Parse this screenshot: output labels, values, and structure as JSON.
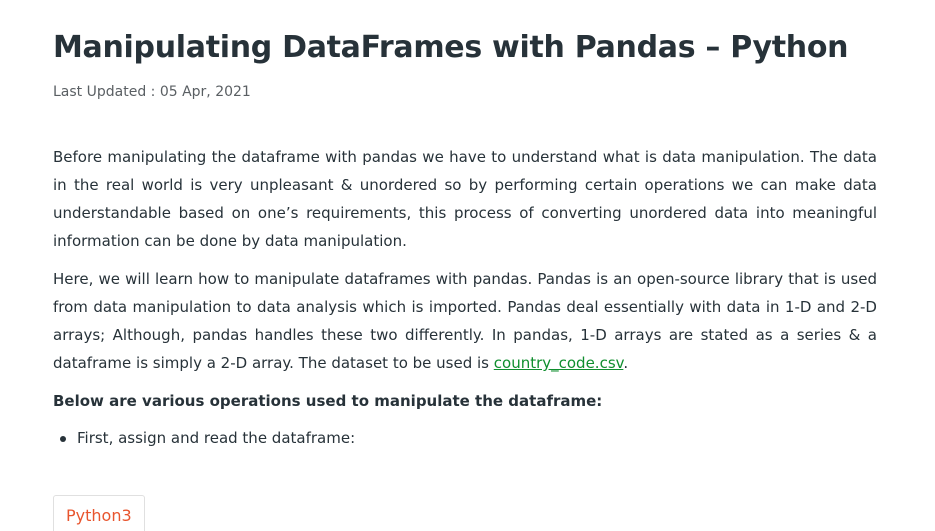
{
  "article": {
    "title": "Manipulating DataFrames with Pandas – Python",
    "last_updated": "Last Updated : 05 Apr, 2021",
    "paragraph1": "Before manipulating the dataframe with pandas we have to understand what is data manipulation. The data in the real world is very unpleasant & unordered so by performing certain operations we can make data understandable based on one’s requirements, this process of converting unordered data into meaningful information can be done by data manipulation.",
    "paragraph2_before_link": "Here, we will learn how to manipulate dataframes with pandas. Pandas is an open-source library that is used from data manipulation to data analysis which is imported. Pandas deal essentially with data in 1-D and 2-D arrays; Although, pandas handles these two differently. In pandas, 1-D arrays are stated as a series & a dataframe is simply a 2-D array. The dataset to be used is ",
    "paragraph2_link": "country_code.csv",
    "paragraph2_after_link": ".",
    "operations_heading": "Below are various operations used to manipulate the dataframe:",
    "bullets": [
      "First, assign and read the dataframe:"
    ],
    "code_tab_label": "Python3"
  },
  "colors": {
    "text": "#273239",
    "link": "#0f8e2e",
    "code_tab": "#e8552e"
  }
}
